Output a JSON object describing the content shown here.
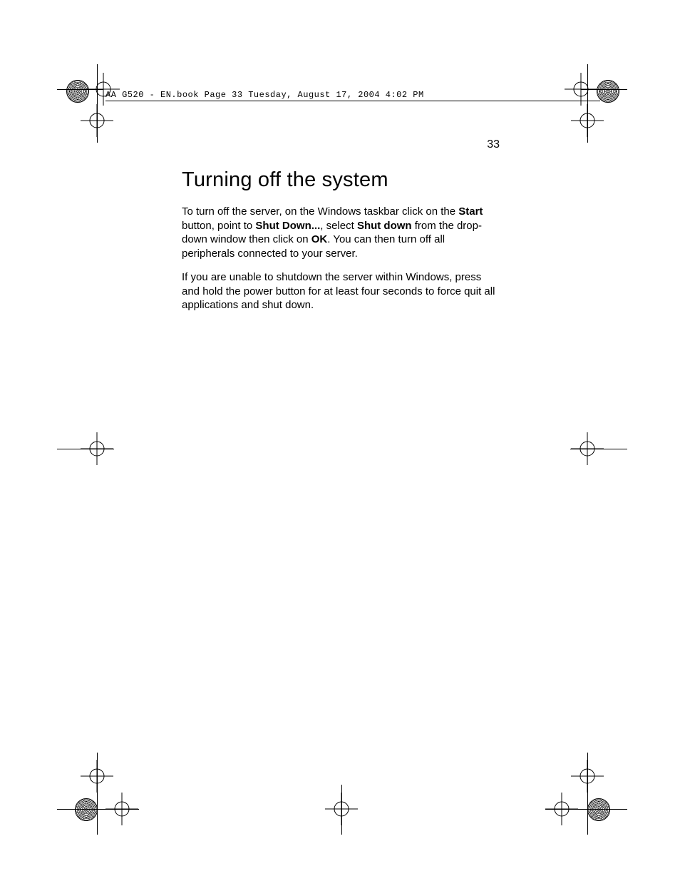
{
  "header": {
    "running_head": "AA G520 - EN.book  Page 33  Tuesday, August 17, 2004  4:02 PM"
  },
  "page_number": "33",
  "title": "Turning off the system",
  "paragraphs": {
    "p1_a": "To turn off the server, on the Windows taskbar click on the ",
    "p1_b": "Start",
    "p1_c": " button, point to ",
    "p1_d": "Shut Down...",
    "p1_e": ", select ",
    "p1_f": "Shut down",
    "p1_g": " from the drop-down window then click on ",
    "p1_h": "OK",
    "p1_i": ".  You can then turn off all peripherals connected to your server.",
    "p2": "If you are unable to shutdown the server within Windows,  press and hold the power button for at least four seconds to force quit all applications and shut down."
  }
}
